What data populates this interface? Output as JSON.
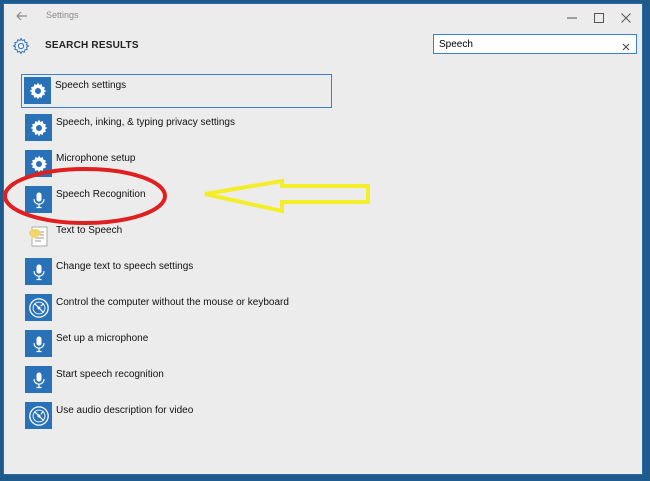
{
  "window": {
    "title": "Settings",
    "accent_color": "#2a72b8",
    "back_icon": "arrow-left-icon",
    "controls": [
      "minimize-icon",
      "maximize-icon",
      "close-icon"
    ]
  },
  "header": {
    "icon": "gear-icon",
    "title": "SEARCH RESULTS"
  },
  "search": {
    "value": "Speech",
    "clear_icon": "clear-icon"
  },
  "results": [
    {
      "label": "Speech settings",
      "icon": "gear-icon",
      "selected": true
    },
    {
      "label": "Speech, inking, & typing privacy settings",
      "icon": "gear-icon"
    },
    {
      "label": "Microphone setup",
      "icon": "gear-icon"
    },
    {
      "label": "Speech Recognition",
      "icon": "microphone-icon"
    },
    {
      "label": "Text to Speech",
      "icon": "text-to-speech-icon"
    },
    {
      "label": "Change text to speech settings",
      "icon": "microphone-icon"
    },
    {
      "label": "Control the computer without the mouse or keyboard",
      "icon": "ease-of-access-icon"
    },
    {
      "label": "Set up a microphone",
      "icon": "microphone-icon"
    },
    {
      "label": "Start speech recognition",
      "icon": "microphone-icon"
    },
    {
      "label": "Use audio description for video",
      "icon": "ease-of-access-icon"
    }
  ],
  "annotations": {
    "highlight_ellipse": {
      "color": "#e02020",
      "target": "Speech Recognition"
    },
    "arrow": {
      "color": "#f4ee2a",
      "direction": "left"
    }
  }
}
